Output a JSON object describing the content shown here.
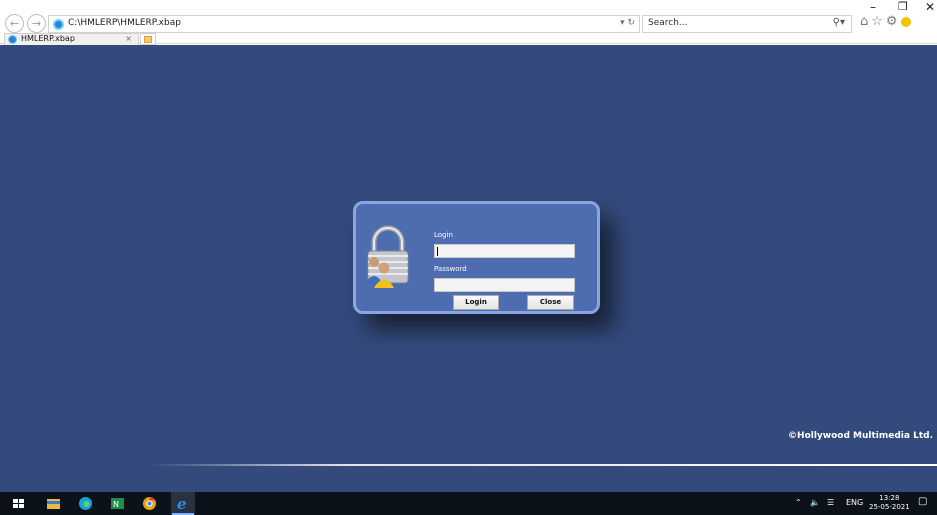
{
  "browser": {
    "address": "C:\\HMLERP\\HMLERP.xbap",
    "address_controls": "▾ ↻",
    "search_placeholder": "Search...",
    "tab_title": "HMLERP.xbap",
    "tab_close": "×"
  },
  "login": {
    "login_label": "Login",
    "login_value": "",
    "password_label": "Password",
    "password_value": "",
    "login_button": "Login",
    "close_button": "Close"
  },
  "footer": {
    "copyright": "©Hollywood Multimedia Ltd."
  },
  "taskbar": {
    "language": "ENG",
    "time": "13:28",
    "date": "25-05-2021"
  },
  "colors": {
    "app_background": "#344a7c",
    "dialog_background": "#4e6cb0",
    "dialog_border": "#8aa6dd"
  }
}
